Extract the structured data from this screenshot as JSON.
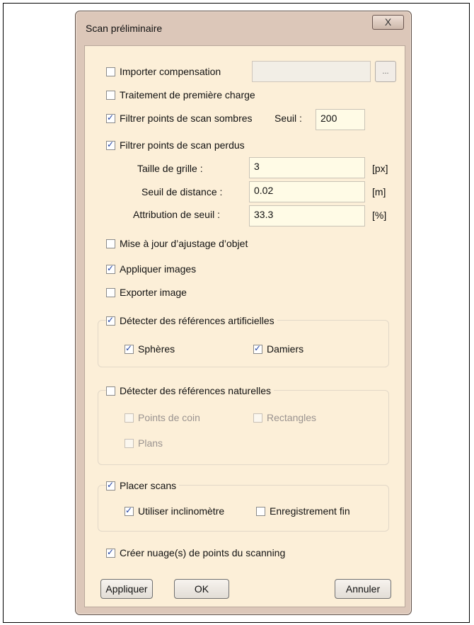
{
  "window": {
    "title": "Scan préliminaire",
    "close_glyph": "X"
  },
  "options": {
    "importer_compensation": {
      "label": "Importer compensation",
      "checked": false,
      "value": "",
      "browse_label": "..."
    },
    "traitement_premiere_charge": {
      "label": "Traitement de première charge",
      "checked": false
    },
    "filtrer_sombres": {
      "label": "Filtrer points de scan sombres",
      "checked": true,
      "seuil_label": "Seuil :",
      "seuil_value": "200"
    },
    "filtrer_perdus": {
      "label": "Filtrer points de scan perdus",
      "checked": true
    },
    "taille_grille": {
      "label": "Taille de grille :",
      "value": "3",
      "unit": "[px]"
    },
    "seuil_distance": {
      "label": "Seuil de distance :",
      "value": "0.02",
      "unit": "[m]"
    },
    "attribution_seuil": {
      "label": "Attribution de seuil :",
      "value": "33.3",
      "unit": "[%]"
    },
    "mise_a_jour": {
      "label": "Mise à jour d’ajustage d’objet",
      "checked": false
    },
    "appliquer_images": {
      "label": "Appliquer images",
      "checked": true
    },
    "exporter_image": {
      "label": "Exporter image",
      "checked": false
    }
  },
  "refs_artificielles": {
    "label": "Détecter des références artificielles",
    "checked": true,
    "spheres": {
      "label": "Sphères",
      "checked": true
    },
    "damiers": {
      "label": "Damiers",
      "checked": true
    }
  },
  "refs_naturelles": {
    "label": "Détecter des références naturelles",
    "checked": false,
    "points_coin": {
      "label": "Points de coin",
      "checked": false
    },
    "rectangles": {
      "label": "Rectangles",
      "checked": false
    },
    "plans": {
      "label": "Plans",
      "checked": false
    }
  },
  "placer_scans": {
    "label": "Placer scans",
    "checked": true,
    "inclinometre": {
      "label": "Utiliser inclinomètre",
      "checked": true
    },
    "enregistrement_fin": {
      "label": "Enregistrement fin",
      "checked": false
    }
  },
  "creer_nuage": {
    "label": "Créer nuage(s) de points du scanning",
    "checked": true
  },
  "buttons": {
    "appliquer": "Appliquer",
    "ok": "OK",
    "annuler": "Annuler"
  }
}
